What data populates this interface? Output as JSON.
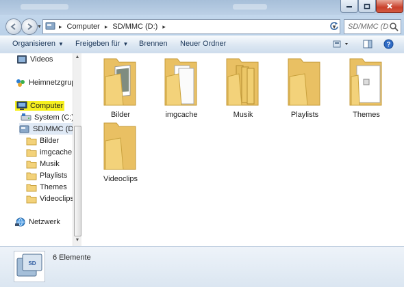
{
  "window": {
    "controls": [
      "minimize",
      "maximize",
      "close"
    ]
  },
  "navigation": {
    "address_segments": [
      "Computer",
      "SD/MMC (D:)"
    ],
    "search_placeholder": "SD/MMC (D:) d..."
  },
  "toolbar": {
    "organize_label": "Organisieren",
    "share_label": "Freigeben für",
    "burn_label": "Brennen",
    "new_folder_label": "Neuer Ordner"
  },
  "sidebar": {
    "items": [
      {
        "label": "Videos",
        "icon": "videos-library-icon"
      },
      {
        "label": "Heimnetzgrupp",
        "icon": "homegroup-icon"
      },
      {
        "label": "Computer",
        "icon": "computer-icon",
        "highlighted": true
      },
      {
        "label": "System (C:)",
        "icon": "drive-icon"
      },
      {
        "label": "SD/MMC (D:)",
        "icon": "sd-card-icon",
        "selected": true
      },
      {
        "label": "Bilder",
        "icon": "folder-icon"
      },
      {
        "label": "imgcache",
        "icon": "folder-icon"
      },
      {
        "label": "Musik",
        "icon": "folder-icon"
      },
      {
        "label": "Playlists",
        "icon": "folder-icon"
      },
      {
        "label": "Themes",
        "icon": "folder-icon"
      },
      {
        "label": "Videoclips",
        "icon": "folder-icon"
      },
      {
        "label": "Netzwerk",
        "icon": "network-icon"
      }
    ]
  },
  "files": [
    {
      "name": "Bilder",
      "icon": "folder-with-photos-icon"
    },
    {
      "name": "imgcache",
      "icon": "folder-with-documents-icon"
    },
    {
      "name": "Musik",
      "icon": "folder-with-documents-icon"
    },
    {
      "name": "Playlists",
      "icon": "folder-icon"
    },
    {
      "name": "Themes",
      "icon": "folder-with-document-icon"
    },
    {
      "name": "Videoclips",
      "icon": "folder-icon"
    }
  ],
  "details": {
    "item_count": "6 Elemente",
    "icon": "sd-card-icon"
  },
  "colors": {
    "highlight": "#f6f01f",
    "folder": "#f3d27a",
    "toolbar_text": "#1e395b"
  }
}
